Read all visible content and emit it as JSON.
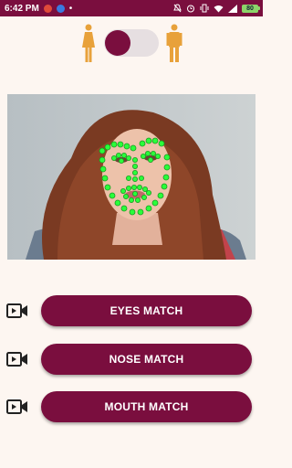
{
  "status_bar": {
    "time": "6:42 PM",
    "battery": "80"
  },
  "buttons": [
    {
      "label": "EYES MATCH"
    },
    {
      "label": "NOSE MATCH"
    },
    {
      "label": "MOUTH MATCH"
    }
  ],
  "colors": {
    "primary": "#7a0e3e",
    "background": "#fdf6f1",
    "gender_icon": "#e8a13a",
    "landmark": "#2aff3a"
  },
  "icons": {
    "female": "female-figure-icon",
    "male": "male-figure-icon",
    "video": "video-camera-icon"
  }
}
